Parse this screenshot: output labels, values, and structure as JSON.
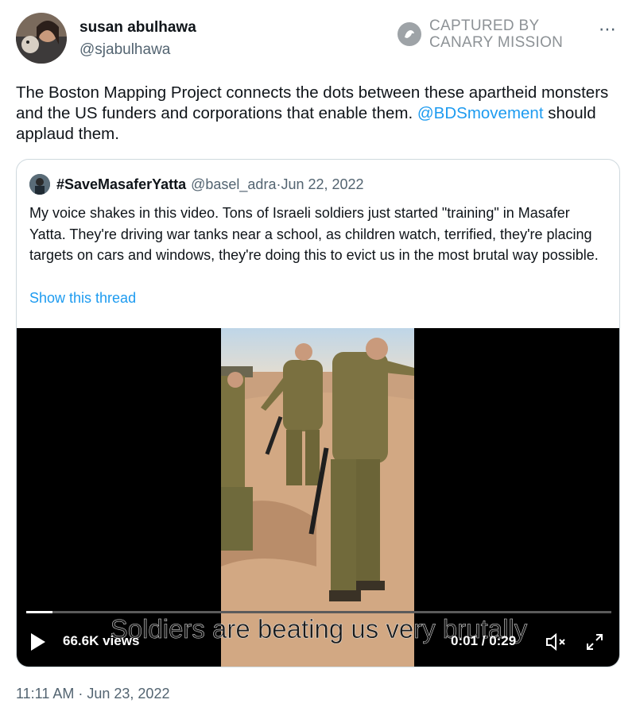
{
  "author": {
    "name": "susan abulhawa",
    "handle": "@sjabulhawa"
  },
  "watermark": {
    "line1": "CAPTURED BY",
    "line2": "CANARY MISSION"
  },
  "more_icon": "⋯",
  "tweet": {
    "text_before": "The Boston Mapping Project connects the dots between these apartheid monsters and the US funders and corporations that enable them. ",
    "mention": "@BDSmovement",
    "text_after": " should applaud them."
  },
  "quote": {
    "name": "#SaveMasaferYatta",
    "handle": "@basel_adra",
    "separator": " · ",
    "date": "Jun 22, 2022",
    "text": "My voice shakes in this video. Tons of Israeli soldiers just started \"training\" in Masafer Yatta. They're driving war tanks near a school, as children watch, terrified, they're placing targets on cars and windows, they're doing this to evict us in the most brutal way possible.",
    "show_thread": "Show this thread"
  },
  "video": {
    "subtitle": "Soldiers are beating us very brutally",
    "views": "66.6K views",
    "time": "0:01 / 0:29",
    "progress": 0.045
  },
  "timestamp": "11:11 AM · Jun 23, 2022",
  "colors": {
    "link": "#1d9bf0",
    "secondary_text": "#536471",
    "border": "#cfd9de"
  }
}
